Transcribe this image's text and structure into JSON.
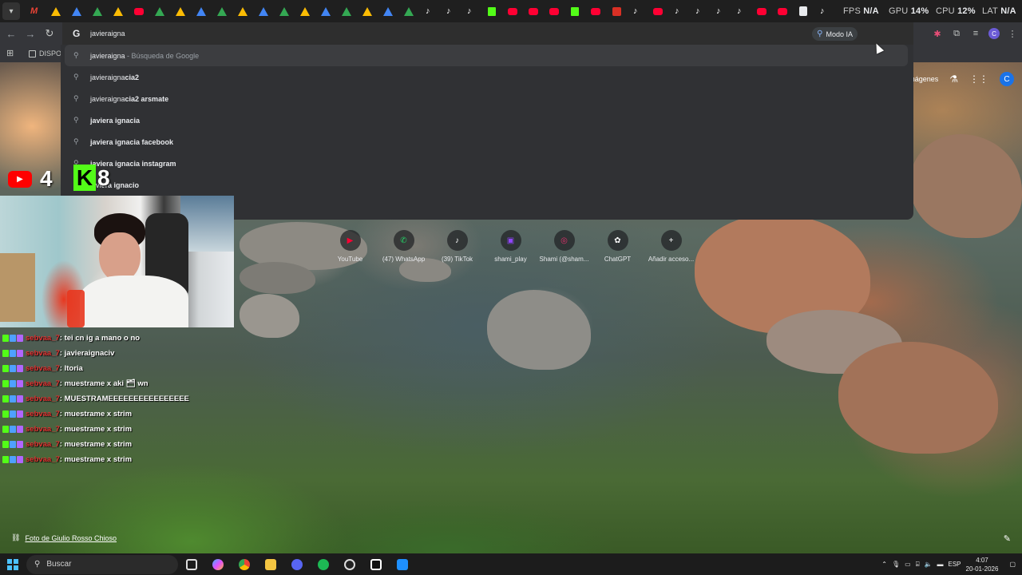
{
  "overlay": {
    "fps_label": "FPS",
    "fps_value": "N/A",
    "gpu_label": "GPU",
    "gpu_value": "14%",
    "cpu_label": "CPU",
    "cpu_value": "12%",
    "lat_label": "LAT",
    "lat_value": "N/A"
  },
  "tabs": {
    "favicons": [
      "gmail",
      "drive",
      "drive",
      "drive",
      "drive",
      "youtube",
      "drive",
      "drive",
      "drive",
      "drive",
      "drive",
      "drive",
      "drive",
      "drive",
      "drive",
      "drive",
      "drive",
      "drive",
      "drive",
      "tiktok",
      "tiktok",
      "tiktok",
      "kick",
      "youtube",
      "youtube",
      "youtube",
      "kick",
      "youtube",
      "red",
      "tiktok",
      "youtube",
      "tiktok",
      "tiktok",
      "tiktok",
      "tiktok",
      "youtube",
      "youtube",
      "doc",
      "tiktok"
    ]
  },
  "omnibox": {
    "value": "javieraigna",
    "modo_ia": "Modo IA"
  },
  "bookmarks": {
    "item": "DISPO"
  },
  "suggestions": [
    {
      "typed": "javieraigna",
      "rest": " - Búsqueda de Google",
      "kind": "search"
    },
    {
      "typed": "javieraigna",
      "rest": "cia2"
    },
    {
      "typed": "javieraigna",
      "rest": "cia2 arsmate"
    },
    {
      "typed": "",
      "rest": "javiera ignacia"
    },
    {
      "typed": "",
      "rest": "javiera ignacia facebook"
    },
    {
      "typed": "",
      "rest": "javiera ignacia instagram"
    },
    {
      "typed": "javi",
      "rest": "era ignacio"
    }
  ],
  "page": {
    "images_link": "Imágenes",
    "avatar_letter": "C",
    "photo_credit": "Foto de Giulio Rosso Chioso"
  },
  "shortcuts": [
    {
      "label": "YouTube",
      "icon": "youtube-icon",
      "color": "#ff0033",
      "glyph": "▶"
    },
    {
      "label": "(47) WhatsApp",
      "icon": "whatsapp-icon",
      "color": "#25d366",
      "glyph": "✆"
    },
    {
      "label": "(39) TikTok",
      "icon": "tiktok-icon",
      "color": "#ffffff",
      "glyph": "♪"
    },
    {
      "label": "shami_play",
      "icon": "twitch-icon",
      "color": "#9146ff",
      "glyph": "▣"
    },
    {
      "label": "Shami (@sham...",
      "icon": "instagram-icon",
      "color": "#e1306c",
      "glyph": "◎"
    },
    {
      "label": "ChatGPT",
      "icon": "chatgpt-icon",
      "color": "#ffffff",
      "glyph": "✿"
    },
    {
      "label": "Añadir acceso...",
      "icon": "plus-icon",
      "color": "#ffffff",
      "glyph": "+"
    }
  ],
  "stream": {
    "youtube_viewers": "4",
    "kick_viewers": "8",
    "kick_logo": "K"
  },
  "chat": [
    {
      "user": "sebvaa_7",
      "msg": ": tei cn ig a mano o no"
    },
    {
      "user": "sebvaa_7",
      "msg": ": javieraignaciv"
    },
    {
      "user": "sebvaa_7",
      "msg": ": ltoria"
    },
    {
      "user": "sebvaa_7",
      "msg": ": muestrame x aki 🗂 wn"
    },
    {
      "user": "sebvaa_7",
      "msg": ": MUESTRAMEEEEEEEEEEEEEEEE"
    },
    {
      "user": "sebvaa_7",
      "msg": ": muestrame x strim"
    },
    {
      "user": "sebvaa_7",
      "msg": ": muestrame x strim"
    },
    {
      "user": "sebvaa_7",
      "msg": ": muestrame x strim"
    },
    {
      "user": "sebvaa_7",
      "msg": ": muestrame x strim"
    }
  ],
  "taskbar": {
    "search": "Buscar",
    "lang": "ESP",
    "time": "4:07",
    "date": "20-01-2026"
  }
}
